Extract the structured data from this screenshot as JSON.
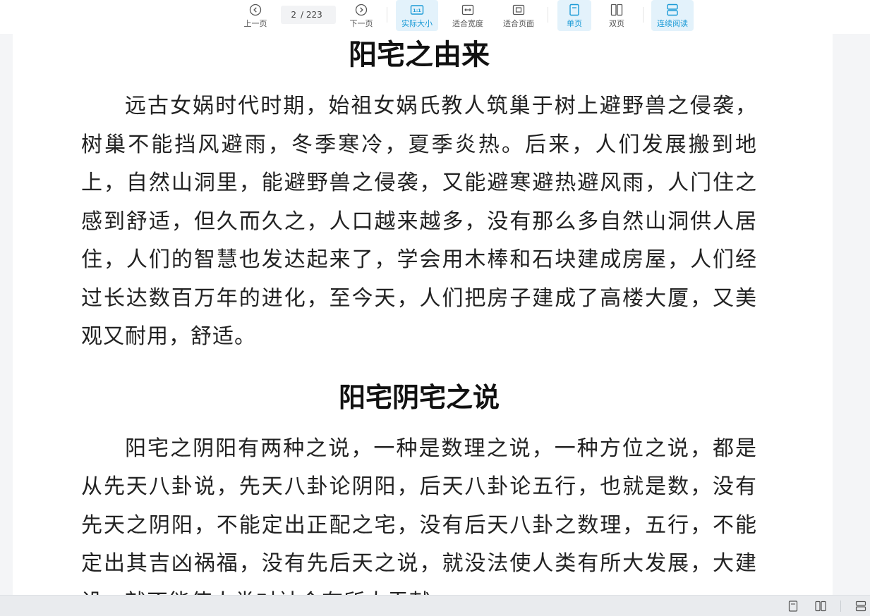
{
  "toolbar": {
    "prev_page": "上一页",
    "page_current": "2",
    "page_total": "/ 223",
    "next_page": "下一页",
    "actual_size": "实际大小",
    "fit_width": "适合宽度",
    "fit_page": "适合页面",
    "single_page": "单页",
    "double_page": "双页",
    "continuous": "连续阅读",
    "actual_size_icon_text": "1:1"
  },
  "document": {
    "heading1": "阳宅之由来",
    "para1": "远古女娲时代时期，始祖女娲氏教人筑巢于树上避野兽之侵袭，树巢不能挡风避雨，冬季寒冷，夏季炎热。后来，人们发展搬到地上，自然山洞里，能避野兽之侵袭，又能避寒避热避风雨，人门住之感到舒适，但久而久之，人口越来越多，没有那么多自然山洞供人居住，人们的智慧也发达起来了，学会用木棒和石块建成房屋，人们经过长达数百万年的进化，至今天，人们把房子建成了高楼大厦，又美观又耐用，舒适。",
    "heading2": "阳宅阴宅之说",
    "para2": "阳宅之阴阳有两种之说，一种是数理之说，一种方位之说，都是从先天八卦说，先天八卦论阴阳，后天八卦论五行，也就是数，没有先天之阴阳，不能定出正配之宅，没有后天八卦之数理，五行，不能定出其吉凶祸福，没有先后天之说，就没法使人类有所大发展，大建设，就不能使人类对社会有所大贡献。"
  },
  "colors": {
    "accent": "#1a9ad6",
    "active_bg": "#e3f2fb"
  }
}
